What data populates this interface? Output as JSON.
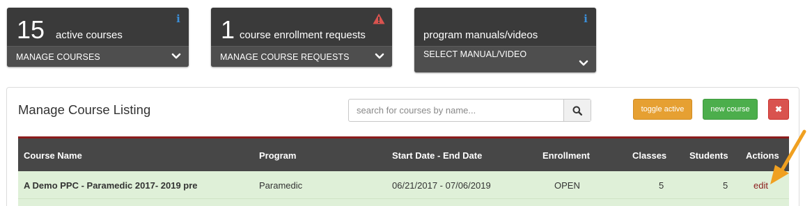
{
  "tiles": [
    {
      "count": "15",
      "description": "active courses",
      "action": "MANAGE COURSES",
      "icon": "info-icon"
    },
    {
      "count": "1",
      "description": "course enrollment requests",
      "action": "MANAGE COURSE REQUESTS",
      "icon": "warning-icon"
    },
    {
      "count": "",
      "description": "program manuals/videos",
      "action": "SELECT MANUAL/VIDEO",
      "icon": "info-icon"
    }
  ],
  "panel": {
    "title": "Manage Course Listing",
    "search_placeholder": "search for courses by name...",
    "toggle_label": "toggle active",
    "new_label": "new course",
    "close_label": "✖"
  },
  "table": {
    "headers": [
      "Course Name",
      "Program",
      "Start Date - End Date",
      "Enrollment",
      "Classes",
      "Students",
      "Actions"
    ],
    "rows": [
      {
        "name": "A Demo PPC - Paramedic 2017- 2019 pre",
        "program": "Paramedic",
        "dates": "06/21/2017 - 07/06/2019",
        "enrollment": "OPEN",
        "classes": "5",
        "students": "5",
        "action": "edit"
      }
    ]
  },
  "colors": {
    "tile_bg": "#3a3a3a",
    "info_blue": "#3b8fd9",
    "warn_red": "#d9534f",
    "toggle_orange": "#e6a032",
    "new_green": "#4cae4c",
    "header_accent": "#8b1c1c",
    "row_green": "#dff0d8",
    "arrow_orange": "#f0a020"
  }
}
